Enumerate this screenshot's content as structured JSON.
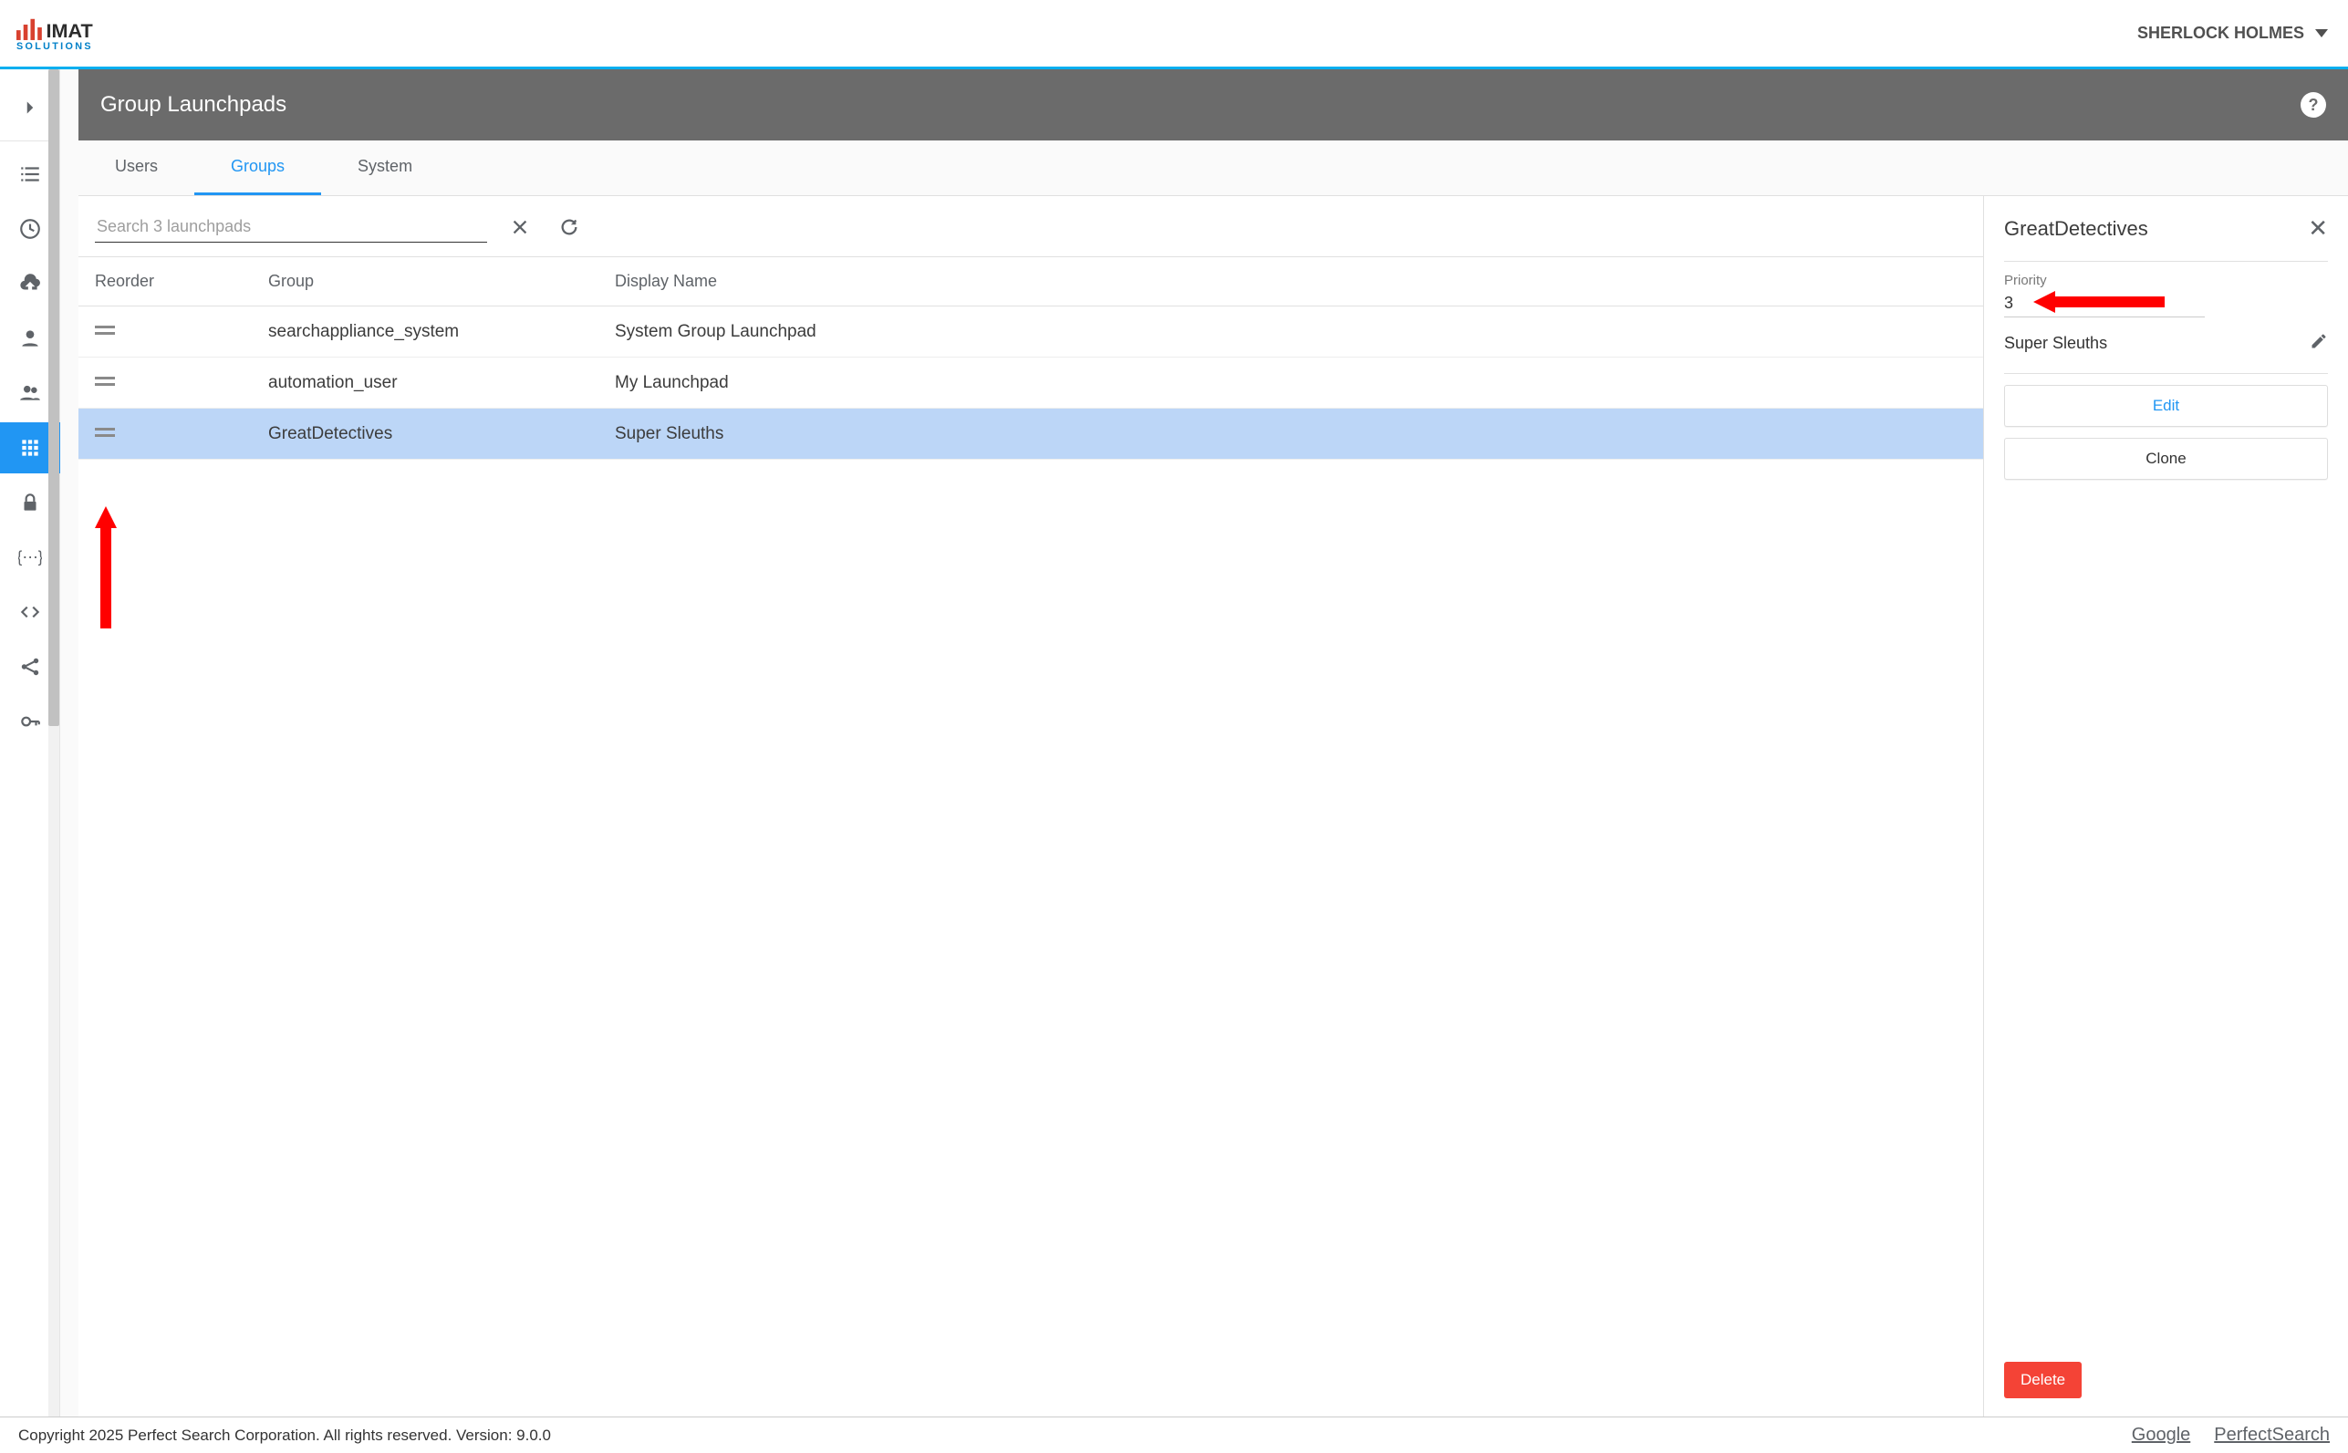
{
  "header": {
    "user_name": "SHERLOCK HOLMES"
  },
  "page_title": "Group Launchpads",
  "tabs": {
    "users": "Users",
    "groups": "Groups",
    "system": "System"
  },
  "search": {
    "placeholder": "Search 3 launchpads"
  },
  "table": {
    "columns": {
      "reorder": "Reorder",
      "group": "Group",
      "display": "Display Name"
    },
    "rows": [
      {
        "group": "searchappliance_system",
        "display": "System Group Launchpad"
      },
      {
        "group": "automation_user",
        "display": "My Launchpad"
      },
      {
        "group": "GreatDetectives",
        "display": "Super Sleuths"
      }
    ]
  },
  "panel": {
    "title": "GreatDetectives",
    "priority_label": "Priority",
    "priority_value": "3",
    "display_name": "Super Sleuths",
    "edit": "Edit",
    "clone": "Clone",
    "delete": "Delete"
  },
  "footer": {
    "copyright": "Copyright 2025 Perfect Search Corporation. All rights reserved. Version: 9.0.0",
    "link_google": "Google",
    "link_ps": "PerfectSearch"
  }
}
